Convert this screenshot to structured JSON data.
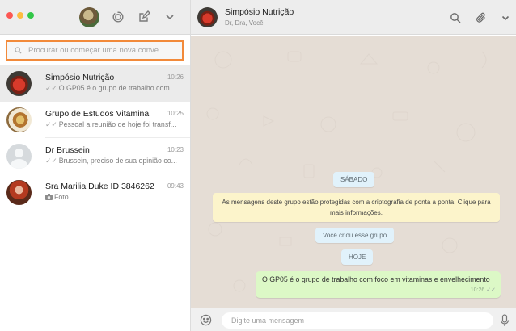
{
  "left_header": {
    "traffic_lights": {
      "red": "#fc5753",
      "yellow": "#fdbc40",
      "green": "#33c748"
    },
    "icons": [
      "status-icon",
      "new-chat-icon",
      "chevron-down-icon"
    ]
  },
  "search": {
    "placeholder": "Procurar ou começar uma nova conve...",
    "icon": "search-icon",
    "focus_color": "#f28a3a"
  },
  "chats": [
    {
      "name": "Simpósio Nutrição",
      "time": "10:26",
      "ticks": "✓✓",
      "preview": "O GP05 é o grupo de trabalho com ...",
      "active": true
    },
    {
      "name": "Grupo de Estudos Vitamina",
      "time": "10:25",
      "ticks": "✓✓",
      "preview": "Pessoal a reunião de hoje foi transf...",
      "active": false
    },
    {
      "name": "Dr Brussein",
      "time": "10:23",
      "ticks": "✓✓",
      "preview": "Brussein, preciso de sua opinião co...",
      "active": false
    },
    {
      "name": "Sra Marilia Duke ID 3846262",
      "time": "09:43",
      "ticks": "",
      "preview": "Foto",
      "preview_icon": "camera-icon",
      "active": false
    }
  ],
  "conversation": {
    "title": "Simpósio Nutrição",
    "subtitle": "Dr, Dra, Você",
    "header_icons": [
      "search-icon",
      "paperclip-icon",
      "chevron-down-icon"
    ],
    "day_label_1": "SÁBADO",
    "encryption_notice": "As mensagens deste grupo estão protegidas com a criptografia de ponta a ponta. Clique para mais informações.",
    "system_created": "Você criou esse grupo",
    "day_label_2": "HOJE",
    "message": {
      "text": "O GP05 é o grupo de trabalho com foco em vitaminas e envelhecimento",
      "time": "10:26",
      "ticks": "✓✓"
    }
  },
  "composer": {
    "placeholder": "Digite uma mensagem",
    "icons": [
      "emoji-icon",
      "microphone-icon"
    ]
  },
  "colors": {
    "header_bg": "#ededed",
    "chat_bg": "#e5ddd5",
    "outgoing_bubble": "#dcf8c6",
    "notice_bg": "#fcf4cb",
    "system_pill": "#e1f2fb"
  }
}
